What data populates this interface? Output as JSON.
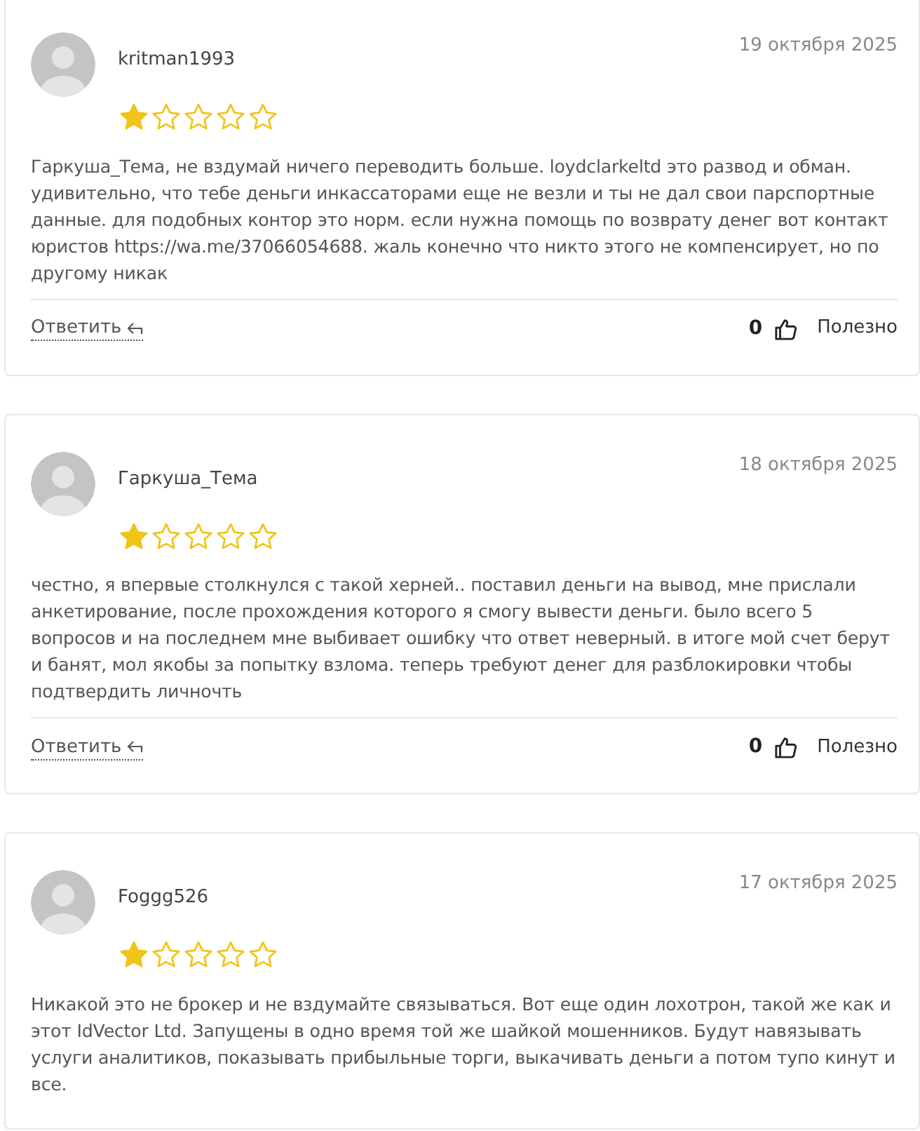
{
  "reviews": [
    {
      "author": "kritman1993",
      "date": "19 октября 2025",
      "stars": 1,
      "text": "Гаркуша_Тема, не вздумай ничего переводить больше. loydclarkeltd это развод и обман. удивительно, что тебе деньги инкассаторами еще не везли и ты не дал свои парспортные данные. для подобных контор это норм. если нужна помощь по возврату денег вот контакт юристов https://wa.me/37066054688. жаль конечно что никто этого не компенсирует, но по другому никак",
      "reply": "Ответить",
      "likes": "0",
      "helpful": "Полезно"
    },
    {
      "author": "Гаркуша_Тема",
      "date": "18 октября 2025",
      "stars": 1,
      "text": "честно, я впервые столкнулся с такой херней.. поставил деньги на вывод, мне прислали анкетирование, после прохождения которого я смогу вывести деньги. было всего 5 вопросов и на последнем мне выбивает ошибку что ответ неверный. в итоге мой счет берут и банят, мол якобы за попытку взлома. теперь требуют денег для разблокировки чтобы подтвердить личночть",
      "reply": "Ответить",
      "likes": "0",
      "helpful": "Полезно"
    },
    {
      "author": "Foggg526",
      "date": "17 октября 2025",
      "stars": 1,
      "text": "Никакой это не брокер и не вздумайте связываться. Вот еще один лохотрон, такой же как и этот IdVector Ltd. Запущены в одно время той же шайкой мошенников. Будут навязывать услуги аналитиков, показывать прибыльные торги, выкачивать деньги а потом тупо кинут и все."
    }
  ]
}
